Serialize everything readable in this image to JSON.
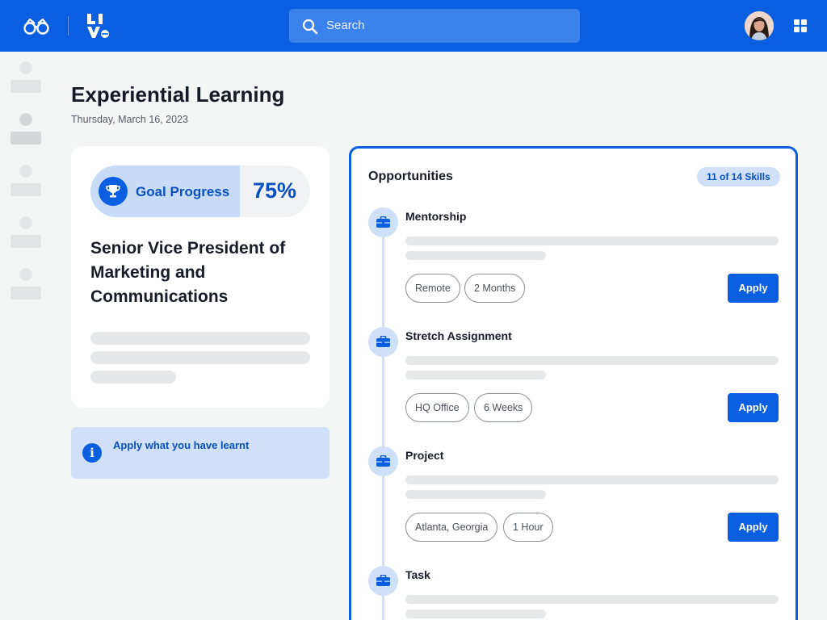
{
  "header": {
    "search_placeholder": "Search",
    "brand_color": "#0a5ee0",
    "icons": [
      "glasses-logo-icon",
      "live-logo-icon",
      "search-icon",
      "user-avatar",
      "apps-grid-icon"
    ]
  },
  "page": {
    "title": "Experiential Learning",
    "date": "Thursday, March 16, 2023"
  },
  "goal": {
    "label": "Goal Progress",
    "percent_text": "75%",
    "progress": 0.75,
    "role_title": "Senior Vice President of Marketing and Communications"
  },
  "info": {
    "text": "Apply what you have learnt"
  },
  "opportunities": {
    "title": "Opportunities",
    "skills_badge": "11 of 14 Skills",
    "items": [
      {
        "name": "Mentorship",
        "tags": [
          "Remote",
          "2 Months"
        ],
        "action": "Apply"
      },
      {
        "name": "Stretch Assignment",
        "tags": [
          "HQ Office",
          "6 Weeks"
        ],
        "action": "Apply"
      },
      {
        "name": "Project",
        "tags": [
          "Atlanta, Georgia",
          "1 Hour"
        ],
        "action": "Apply"
      },
      {
        "name": "Task",
        "tags": [],
        "action": ""
      }
    ]
  }
}
